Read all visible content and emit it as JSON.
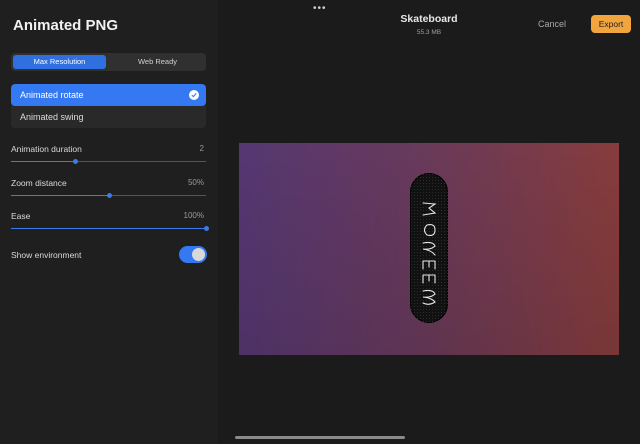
{
  "panel": {
    "title": "Animated PNG",
    "segmented": {
      "options": [
        "Max Resolution",
        "Web Ready"
      ],
      "selected": "Max Resolution"
    },
    "animation_types": [
      {
        "label": "Animated rotate",
        "selected": true
      },
      {
        "label": "Animated swing",
        "selected": false
      }
    ],
    "sliders": [
      {
        "label": "Animation duration",
        "value": "2",
        "fraction": 0.33
      },
      {
        "label": "Zoom distance",
        "value": "50%",
        "fraction": 0.5
      },
      {
        "label": "Ease",
        "value": "100%",
        "fraction": 1.0
      }
    ],
    "environment": {
      "label": "Show environment",
      "on": true
    }
  },
  "header": {
    "dots": "•••",
    "title": "Skateboard",
    "size": "55.3 MB",
    "cancel_label": "Cancel",
    "export_label": "Export"
  },
  "colors": {
    "accent": "#3479f2",
    "export": "#f1a53c"
  }
}
